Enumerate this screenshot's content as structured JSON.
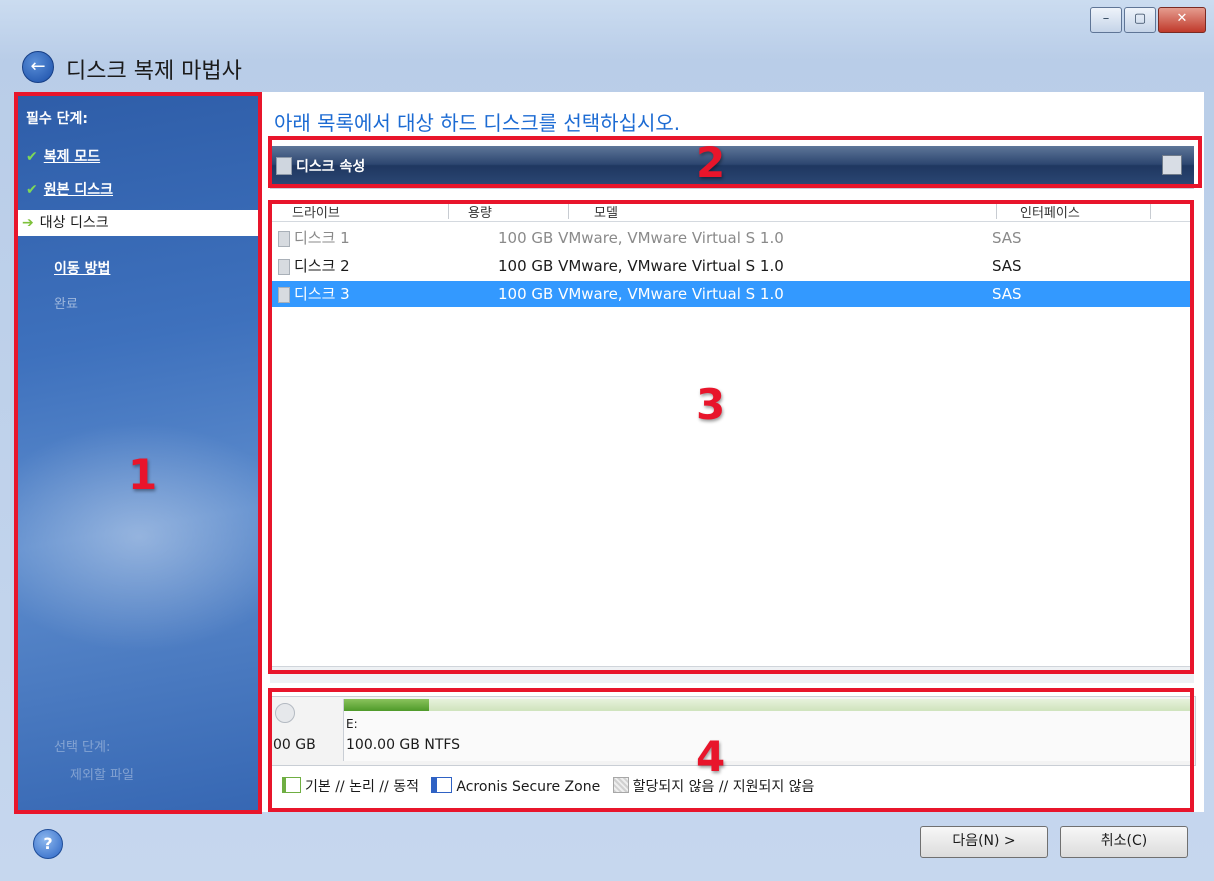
{
  "window": {
    "title": "디스크 복제 마법사",
    "min_label": "–",
    "max_label": "▢",
    "close_label": "✕"
  },
  "sidebar": {
    "heading": "필수 단계:",
    "steps": [
      {
        "label": "복제 모드",
        "state": "done"
      },
      {
        "label": "원본 디스크",
        "state": "done"
      },
      {
        "label": "대상 디스크",
        "state": "current"
      },
      {
        "label": "이동 방법",
        "state": "pending"
      },
      {
        "label": "완료",
        "state": "disabled"
      }
    ],
    "check_mark": "✔",
    "current_marker": "➔",
    "optional_heading": "선택 단계:",
    "optional_item": "제외할 파일"
  },
  "main": {
    "instruction": "아래 목록에서 대상 하드 디스크를 선택하십시오.",
    "toolbar_label": "디스크 속성",
    "columns": [
      "드라이브",
      "용량",
      "모델",
      "인터페이스"
    ],
    "rows": [
      {
        "drive": "디스크 1",
        "capacity_model": "100 GB VMware, VMware Virtual S 1.0",
        "interface": "SAS",
        "state": "dim"
      },
      {
        "drive": "디스크 2",
        "capacity_model": "100 GB VMware, VMware Virtual S 1.0",
        "interface": "SAS",
        "state": "normal"
      },
      {
        "drive": "디스크 3",
        "capacity_model": "100 GB VMware, VMware Virtual S 1.0",
        "interface": "SAS",
        "state": "selected"
      }
    ]
  },
  "disk_panel": {
    "size_label": "00 GB",
    "partition_drive": "E:",
    "partition_detail": "100.00 GB  NTFS",
    "used_fraction": 0.1
  },
  "legend": {
    "basic": "기본 // 논리 // 동적",
    "asz": "Acronis Secure Zone",
    "unallocated": "할당되지 않음 // 지원되지 않음"
  },
  "annotations": [
    "1",
    "2",
    "3",
    "4"
  ],
  "buttons": {
    "help": "?",
    "next": "다음(N) >",
    "cancel": "취소(C)"
  },
  "colors": {
    "annotation": "#e8152b",
    "selection": "#3399ff",
    "link": "#1c6bd3"
  }
}
